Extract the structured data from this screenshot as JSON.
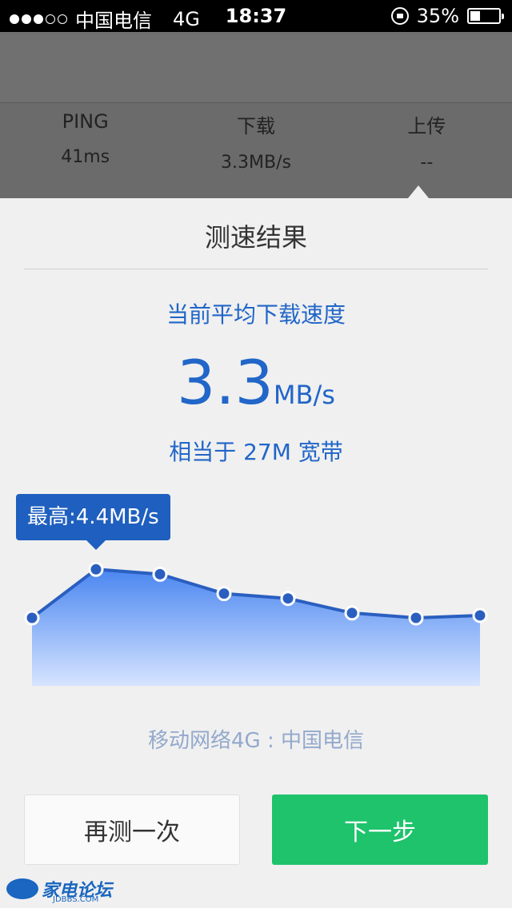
{
  "status_bar": {
    "signal_bars_full": 3,
    "signal_bars_total": 5,
    "carrier": "中国电信",
    "network": "4G",
    "time": "18:37",
    "battery_percent_label": "35%",
    "battery_level": 0.35
  },
  "stats": [
    {
      "label": "PING",
      "value": "41ms"
    },
    {
      "label": "下载",
      "value": "3.3MB/s"
    },
    {
      "label": "上传",
      "value": "--"
    }
  ],
  "result": {
    "title": "测速结果",
    "avg_label": "当前平均下载速度",
    "speed_value": "3.3",
    "speed_unit": "MB/s",
    "equivalent": "相当于 27M 宽带"
  },
  "chart_data": {
    "type": "area",
    "peak_label": "最高:4.4MB/s",
    "peak_index": 1,
    "values": [
      3.4,
      4.4,
      4.3,
      3.9,
      3.8,
      3.5,
      3.4,
      3.45
    ],
    "ylim": [
      2.0,
      4.8
    ],
    "colors": {
      "line": "#2a5fc0",
      "fill_top": "#4a86f0",
      "fill_bottom": "#d6e4ff"
    }
  },
  "network_info": "移动网络4G : 中国电信",
  "buttons": {
    "retry": "再测一次",
    "next": "下一步"
  },
  "watermark": {
    "text": "家电论坛",
    "sub": "JDBBS.COM"
  }
}
